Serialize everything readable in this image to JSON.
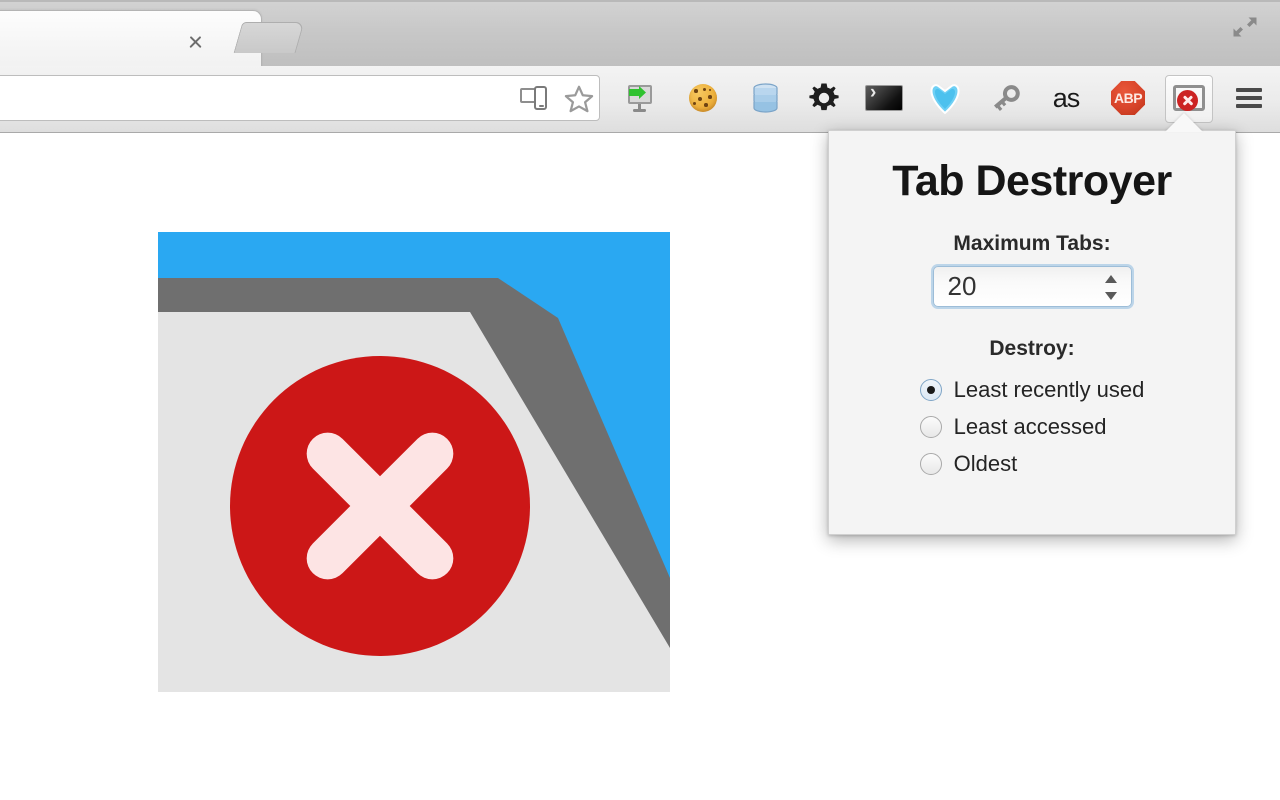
{
  "browser": {
    "tab": {
      "title": "",
      "close_label": "×"
    },
    "new_tab_button": "+",
    "window_maximize": "maximize-restore",
    "omnibox": {
      "value": "",
      "placeholder": ""
    },
    "omnibox_icons": [
      {
        "name": "devices-icon",
        "label": "Devices"
      },
      {
        "name": "bookmark-star-icon",
        "label": "Bookmark this page"
      }
    ],
    "extension_icons": [
      {
        "name": "cast-icon",
        "label": "Cast"
      },
      {
        "name": "cookie-icon",
        "label": "Cookies"
      },
      {
        "name": "database-icon",
        "label": "Database"
      },
      {
        "name": "gear-icon",
        "label": "Settings"
      },
      {
        "name": "terminal-icon",
        "label": "Console"
      },
      {
        "name": "diamond-icon",
        "label": "Diamond"
      },
      {
        "name": "key-icon",
        "label": "Key"
      },
      {
        "name": "lastfm-icon",
        "label": "as"
      },
      {
        "name": "adblock-icon",
        "label": "ABP"
      },
      {
        "name": "tab-destroyer-icon",
        "label": "Tab Destroyer"
      }
    ],
    "menu_button": "chrome-menu"
  },
  "popup": {
    "title": "Tab Destroyer",
    "max_tabs": {
      "label": "Maximum Tabs:",
      "value": "20",
      "placeholder": "20"
    },
    "destroy": {
      "label": "Destroy:",
      "options": [
        {
          "label": "Least recently used",
          "selected": true
        },
        {
          "label": "Least accessed",
          "selected": false
        },
        {
          "label": "Oldest",
          "selected": false
        }
      ]
    }
  },
  "page": {
    "promo_logo": {
      "alt": "Tab Destroyer logo",
      "background_color": "#2aa8f2",
      "window_border_color": "#6f6f6f",
      "window_body_color": "#e4e4e4",
      "badge_color": "#cc1717",
      "badge_x_color": "#fde4e4"
    }
  },
  "colors": {
    "accent_blue": "#2aa8f2",
    "badge_red": "#cc1717",
    "toolbar_bg": "#ebebeb",
    "popup_bg": "#f4f4f4"
  }
}
